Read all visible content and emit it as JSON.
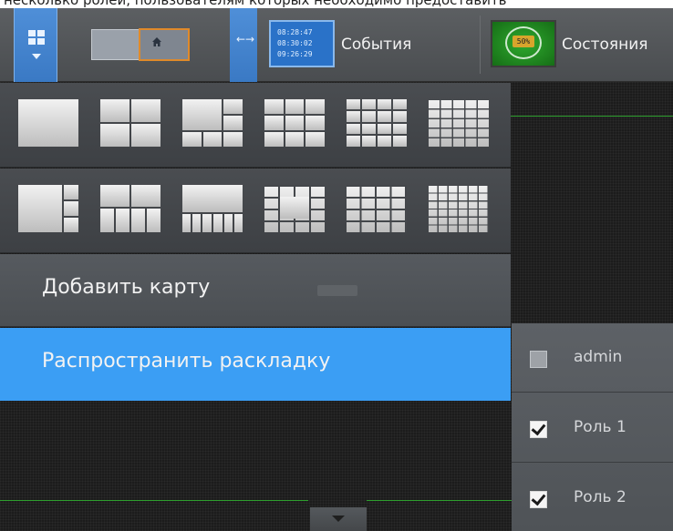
{
  "caption": {
    "text": "несколько ролей, пользователям которых необходимо предоставить"
  },
  "toolbar": {
    "events": {
      "label": "События",
      "times": [
        "08:28:47",
        "08:30:02",
        "09:26:29"
      ]
    },
    "states": {
      "label": "Состояния",
      "percent": "50%"
    }
  },
  "menu": {
    "add_map": "Добавить карту",
    "share_layout": "Распространить раскладку"
  },
  "roles": [
    {
      "label": "admin",
      "checked": false
    },
    {
      "label": "Роль 1",
      "checked": true
    },
    {
      "label": "Роль 2",
      "checked": true
    }
  ],
  "colors": {
    "accent": "#3b9ef4",
    "toolbar_active": "#4587d3",
    "map_frame": "#e08a2a",
    "states_green": "#2a9a2a",
    "grid_line": "#2e9e2e"
  },
  "icons": {
    "layout_menu": "grid-icon",
    "map": "home-icon",
    "split": "split-arrows-icon",
    "events": "event-log-icon",
    "states": "gauge-icon",
    "scroll": "chevron-down-icon"
  }
}
